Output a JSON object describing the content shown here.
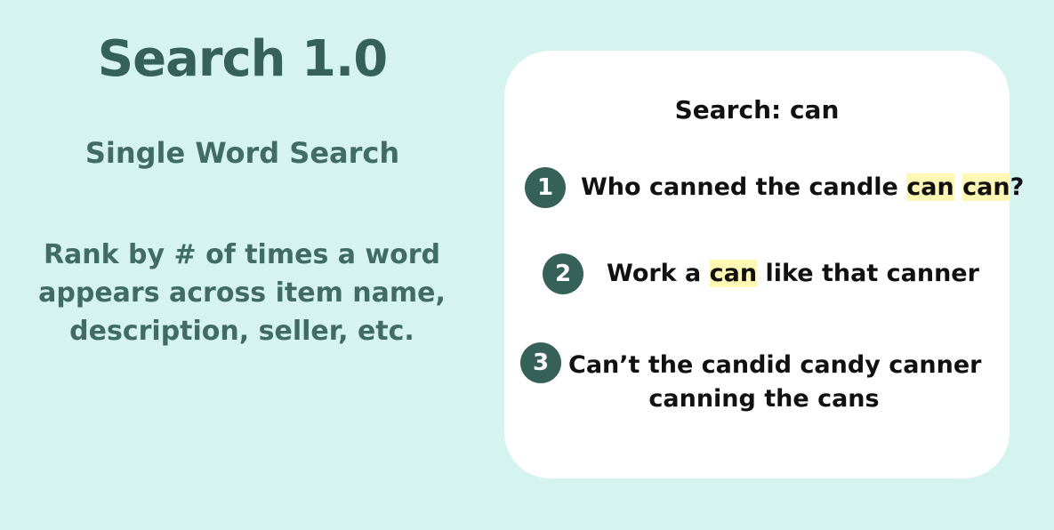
{
  "left_panel": {
    "title": "Search 1.0",
    "subtitle": "Single Word Search",
    "description": "Rank by # of times a word appears across item name, description, seller, etc."
  },
  "search_card": {
    "query_label": "Search: can",
    "highlight_color": "#fff7b3",
    "badge_color": "#356159",
    "results": [
      {
        "rank": "1",
        "parts": [
          "Who canned the candle ",
          "can",
          " ",
          "can",
          "?"
        ]
      },
      {
        "rank": "2",
        "parts": [
          "Work a ",
          "can",
          " like that canner"
        ]
      },
      {
        "rank": "3",
        "line1": "Can’t the candid candy canner",
        "line2": "canning the cans"
      }
    ]
  }
}
